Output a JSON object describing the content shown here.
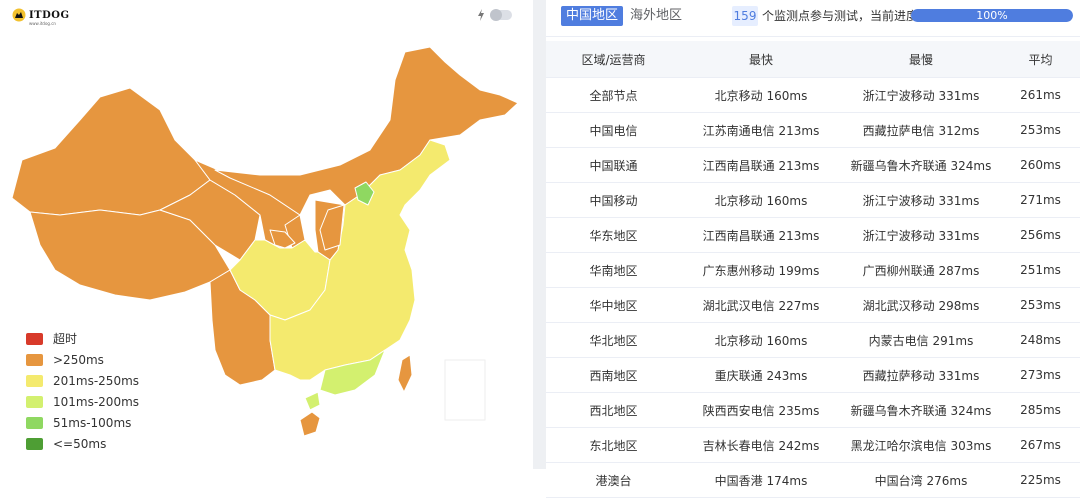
{
  "logo": {
    "text": "ITDOG",
    "subtitle": "www.itdog.cn"
  },
  "legend": [
    {
      "label": "超时",
      "color": "#d83a2a"
    },
    {
      "label": ">250ms",
      "color": "#e6963f"
    },
    {
      "label": "201ms-250ms",
      "color": "#f4ea6e"
    },
    {
      "label": "101ms-200ms",
      "color": "#d3f06f"
    },
    {
      "label": "51ms-100ms",
      "color": "#8fd861"
    },
    {
      "label": "<=50ms",
      "color": "#4e9e34"
    }
  ],
  "tabs": {
    "active": "中国地区",
    "other": "海外地区"
  },
  "status": {
    "count": "159",
    "text": "个监测点参与测试，当前进度：",
    "progress_label": "100%",
    "progress": 1.0
  },
  "table": {
    "headers": [
      "区域/运营商",
      "最快",
      "最慢",
      "平均"
    ],
    "rows": [
      [
        "全部节点",
        "北京移动 160ms",
        "浙江宁波移动 331ms",
        "261ms"
      ],
      [
        "中国电信",
        "江苏南通电信 213ms",
        "西藏拉萨电信 312ms",
        "253ms"
      ],
      [
        "中国联通",
        "江西南昌联通 213ms",
        "新疆乌鲁木齐联通 324ms",
        "260ms"
      ],
      [
        "中国移动",
        "北京移动 160ms",
        "浙江宁波移动 331ms",
        "271ms"
      ],
      [
        "华东地区",
        "江西南昌联通 213ms",
        "浙江宁波移动 331ms",
        "256ms"
      ],
      [
        "华南地区",
        "广东惠州移动 199ms",
        "广西柳州联通 287ms",
        "251ms"
      ],
      [
        "华中地区",
        "湖北武汉电信 227ms",
        "湖北武汉移动 298ms",
        "253ms"
      ],
      [
        "华北地区",
        "北京移动 160ms",
        "内蒙古电信 291ms",
        "248ms"
      ],
      [
        "西南地区",
        "重庆联通 243ms",
        "西藏拉萨移动 331ms",
        "273ms"
      ],
      [
        "西北地区",
        "陕西西安电信 235ms",
        "新疆乌鲁木齐联通 324ms",
        "285ms"
      ],
      [
        "东北地区",
        "吉林长春电信 242ms",
        "黑龙江哈尔滨电信 303ms",
        "267ms"
      ],
      [
        "港澳台",
        "中国香港 174ms",
        "中国台湾 276ms",
        "225ms"
      ]
    ]
  },
  "map_colors": {
    "orange": "#e6963f",
    "yellow": "#f4ea6e",
    "light_green": "#d3f06f",
    "green": "#8fd861",
    "border": "#ffffff"
  },
  "icons": {
    "logo": "dog-logo-icon",
    "bolt": "bolt-icon",
    "toggle": "toggle-switch"
  }
}
